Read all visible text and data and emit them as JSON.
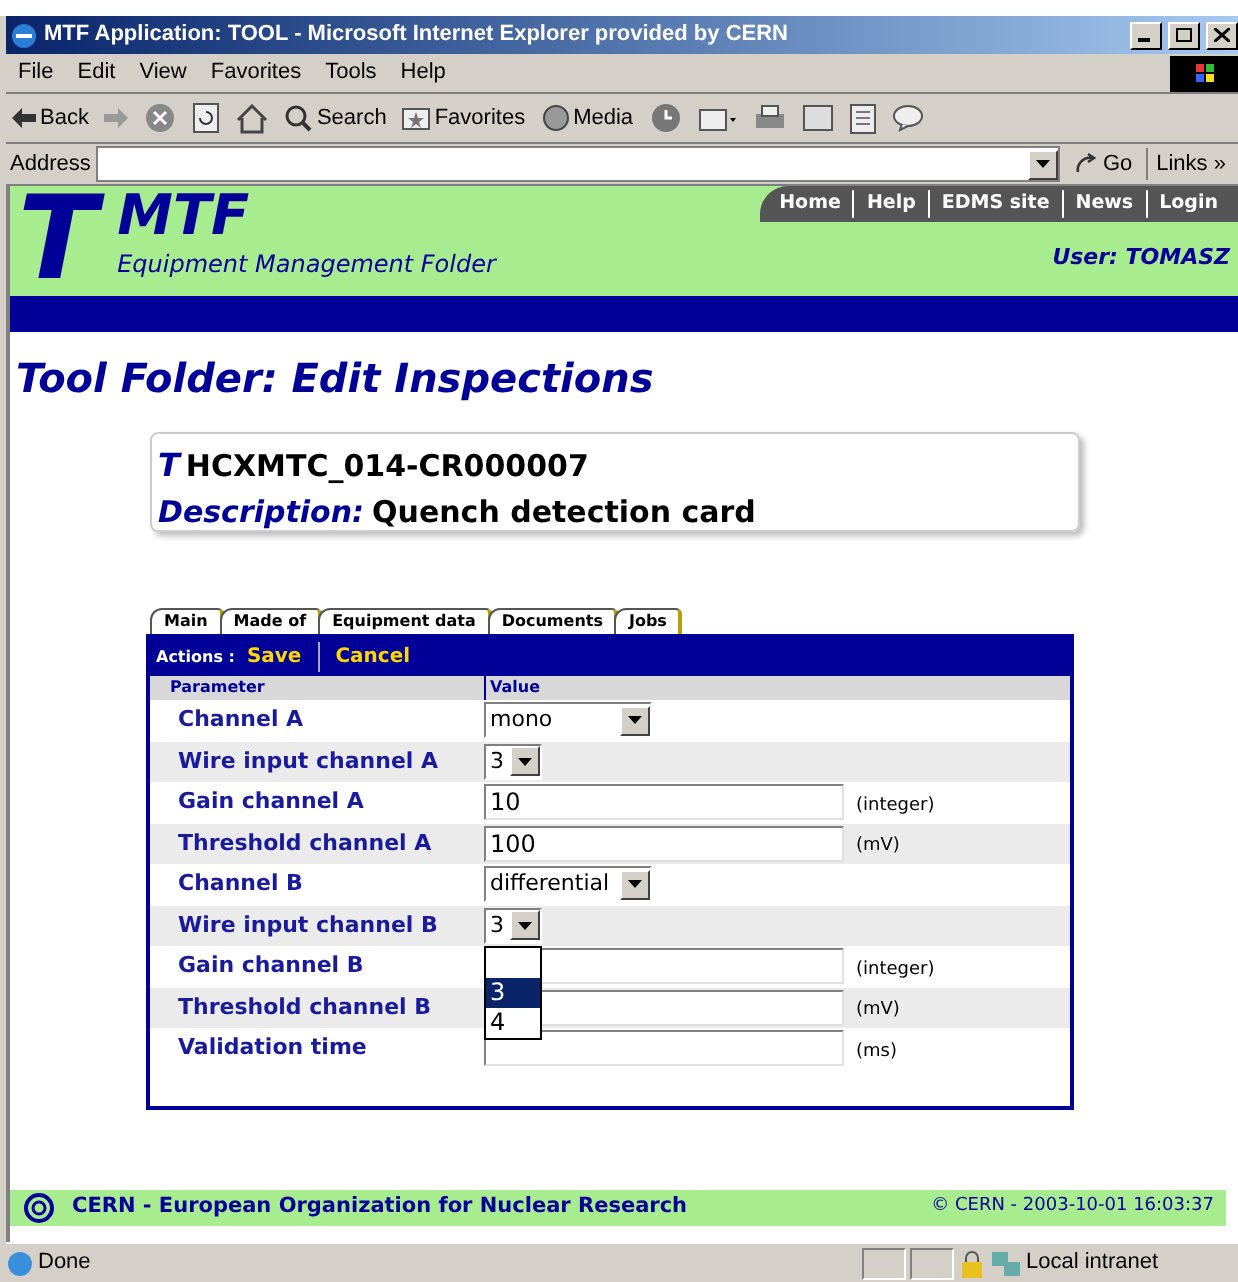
{
  "window": {
    "title": "MTF Application: TOOL - Microsoft Internet Explorer provided by CERN"
  },
  "menu": [
    "File",
    "Edit",
    "View",
    "Favorites",
    "Tools",
    "Help"
  ],
  "toolbar": {
    "back": "Back",
    "search": "Search",
    "favorites": "Favorites",
    "media": "Media"
  },
  "address": {
    "label": "Address",
    "go": "Go",
    "links": "Links",
    "more": "»"
  },
  "header": {
    "logo_letter": "T",
    "title": "MTF",
    "subtitle": "Equipment Management Folder",
    "nav": [
      "Home",
      "Help",
      "EDMS site",
      "News",
      "Login"
    ],
    "user": "User: TOMASZ"
  },
  "page_title": "Tool Folder: Edit Inspections",
  "card": {
    "type_letter": "T",
    "id": "HCXMTC_014-CR000007",
    "description_label": "Description:",
    "description": "Quench detection card"
  },
  "tabs": [
    "Main",
    "Made of",
    "Equipment data",
    "Documents",
    "Jobs"
  ],
  "actions": {
    "label": "Actions :",
    "items": [
      "Save",
      "Cancel"
    ]
  },
  "table": {
    "columns": [
      "Parameter",
      "Value"
    ],
    "rows": [
      {
        "label": "Channel A",
        "kind": "select",
        "value": "mono",
        "wide": true
      },
      {
        "label": "Wire input channel A",
        "kind": "select",
        "value": "3",
        "wide": false
      },
      {
        "label": "Gain channel A",
        "kind": "text",
        "value": "10",
        "unit": "(integer)"
      },
      {
        "label": "Threshold channel A",
        "kind": "text",
        "value": "100",
        "unit": "(mV)"
      },
      {
        "label": "Channel B",
        "kind": "select",
        "value": "differential",
        "wide": true
      },
      {
        "label": "Wire input channel B",
        "kind": "select",
        "value": "3",
        "wide": false,
        "expanded": true,
        "options": [
          {
            "label": "3",
            "selected": true
          },
          {
            "label": "4",
            "selected": false
          }
        ]
      },
      {
        "label": "Gain channel B",
        "kind": "text",
        "unit": "(integer)"
      },
      {
        "label": "Threshold channel B",
        "kind": "text",
        "unit": "(mV)"
      },
      {
        "label": "Validation time",
        "kind": "text",
        "unit": "(ms)"
      }
    ]
  },
  "footer": {
    "org": "CERN - European Organization for Nuclear Research",
    "copyright": "© CERN - 2003-10-01 16:03:37"
  },
  "status_bar": {
    "text": "Done",
    "zone": "Local intranet"
  }
}
